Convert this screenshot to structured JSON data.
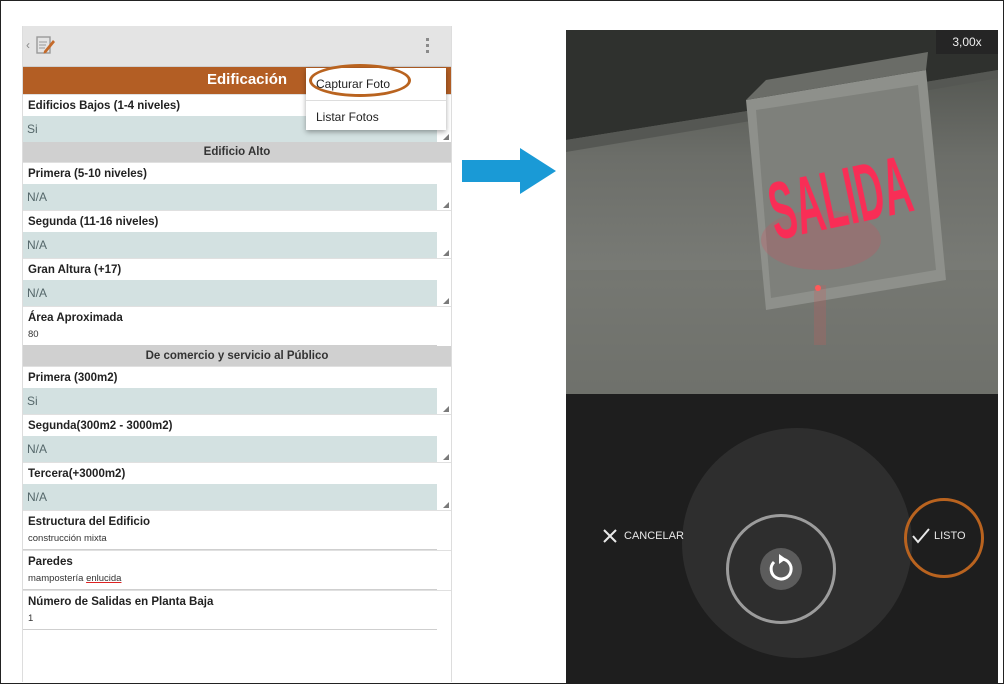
{
  "colors": {
    "accent_orange": "#b35e24",
    "annotation_orange": "#b9631f",
    "arrow_blue": "#1a9ad6",
    "field_bg": "#d3e1e1"
  },
  "left_app": {
    "title": "Edificación",
    "menu": {
      "capture_photo": "Capturar Foto",
      "list_photos": "Listar Fotos"
    },
    "fields": {
      "edificios_bajos": {
        "label": "Edificios Bajos (1-4 niveles)",
        "value": "Si"
      },
      "section_edificio_alto": "Edificio Alto",
      "primera": {
        "label": "Primera (5-10 niveles)",
        "value": "N/A"
      },
      "segunda": {
        "label": "Segunda (11-16 niveles)",
        "value": "N/A"
      },
      "gran_altura": {
        "label": "Gran Altura (+17)",
        "value": "N/A"
      },
      "area": {
        "label": "Área Aproximada",
        "value": "80"
      },
      "section_comercio": "De comercio y servicio al Público",
      "primera_300": {
        "label": "Primera (300m2)",
        "value": "Si"
      },
      "segunda_3000": {
        "label": "Segunda(300m2 - 3000m2)",
        "value": "N/A"
      },
      "tercera": {
        "label": "Tercera(+3000m2)",
        "value": "N/A"
      },
      "estructura": {
        "label": "Estructura del Edificio",
        "value": "construcción mixta"
      },
      "paredes": {
        "label": "Paredes",
        "value_a": "mampostería ",
        "value_b": "enlucida"
      },
      "salidas": {
        "label": "Número de Salidas en Planta Baja",
        "value": "1"
      }
    }
  },
  "camera": {
    "zoom": "3,00x",
    "sign_text": "SALIDA",
    "cancel_label": "CANCELAR",
    "done_label": "LISTO"
  }
}
